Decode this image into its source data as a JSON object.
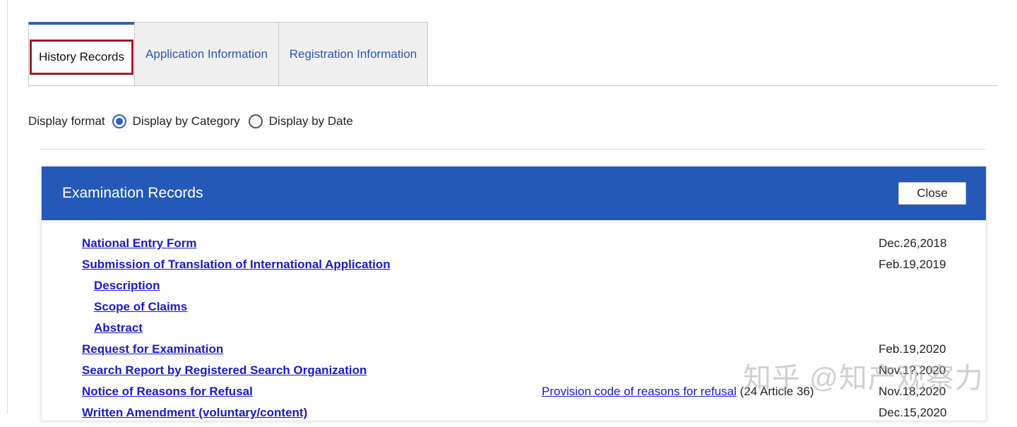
{
  "tabs": [
    {
      "label": "History Records",
      "active": true
    },
    {
      "label": "Application Information",
      "active": false
    },
    {
      "label": "Registration Information",
      "active": false
    }
  ],
  "display_format": {
    "label": "Display format",
    "options": [
      {
        "label": "Display by Category",
        "selected": true
      },
      {
        "label": "Display by Date",
        "selected": false
      }
    ]
  },
  "panel": {
    "title": "Examination Records",
    "close_label": "Close",
    "records": [
      {
        "label": "National Entry Form",
        "date": "Dec.26,2018"
      },
      {
        "label": "Submission of Translation of International Application",
        "date": "Feb.19,2019"
      },
      {
        "label": "Description"
      },
      {
        "label": "Scope of Claims"
      },
      {
        "label": "Abstract"
      },
      {
        "label": "Request for Examination",
        "date": "Feb.19,2020"
      },
      {
        "label": "Search Report by Registered Search Organization",
        "date": "Nov.1?,2020"
      },
      {
        "label": "Notice of Reasons for Refusal",
        "note_link": "Provision code of reasons for refusal",
        "note_text": "(24  Article 36)",
        "date": "Nov.18,2020"
      },
      {
        "label": "Written Amendment (voluntary/content)",
        "date": "Dec.15,2020"
      }
    ]
  },
  "watermark": "知乎 @知产观察力",
  "colors": {
    "header_blue": "#2459b8",
    "link_blue": "#1a1ac8",
    "tab_accent": "#3b5dab",
    "highlight_red": "#a01c24"
  }
}
